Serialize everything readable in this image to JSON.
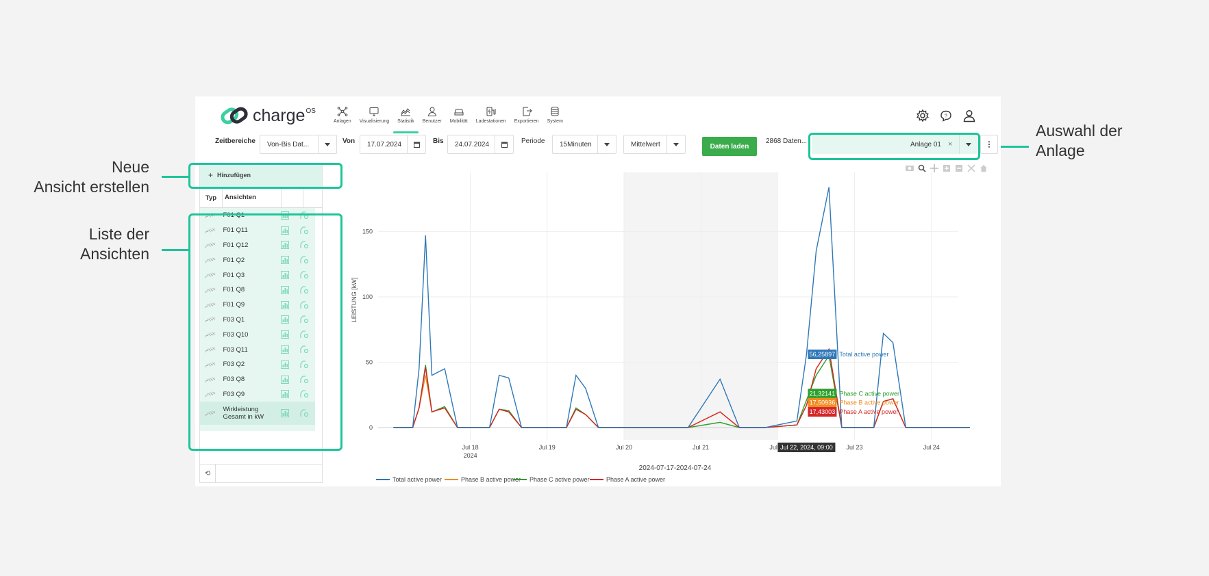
{
  "app": {
    "logo_text": "charge",
    "logo_sup": "OS",
    "nav": [
      {
        "label": "Anlagen",
        "icon": "network-icon"
      },
      {
        "label": "Visualisierung",
        "icon": "monitor-icon"
      },
      {
        "label": "Statistik",
        "icon": "chart-icon",
        "active": true
      },
      {
        "label": "Benutzer",
        "icon": "user-icon"
      },
      {
        "label": "Mobilität",
        "icon": "car-icon"
      },
      {
        "label": "Ladestationen",
        "icon": "charger-icon"
      },
      {
        "label": "Exportieren",
        "icon": "export-icon"
      },
      {
        "label": "System",
        "icon": "database-icon"
      }
    ],
    "header_icons": [
      "settings-icon",
      "chat-help-icon",
      "profile-icon"
    ]
  },
  "toolbar": {
    "zeitbereiche_label": "Zeitbereiche",
    "zeitbereiche_value": "Von-Bis Dat...",
    "von_label": "Von",
    "von_value": "17.07.2024",
    "bis_label": "Bis",
    "bis_value": "24.07.2024",
    "periode_label": "Periode",
    "periode_value": "15Minuten",
    "agg_value": "Mittelwert",
    "load_label": "Daten laden",
    "count_text": "2868 Daten...",
    "anlage_value": "Anlage 01",
    "clear_symbol": "×"
  },
  "sidebar": {
    "add_label": "Hinzufügen",
    "col_typ": "Typ",
    "col_ansichten": "Ansichten",
    "items": [
      "F01 Q1",
      "F01 Q11",
      "F01 Q12",
      "F01 Q2",
      "F01 Q3",
      "F01 Q8",
      "F01 Q9",
      "F03 Q1",
      "F03 Q10",
      "F03 Q11",
      "F03 Q2",
      "F03 Q8",
      "F03 Q9"
    ],
    "last_item_line1": "Wirkleistung",
    "last_item_line2": "Gesamt in kW"
  },
  "chart_data": {
    "type": "line",
    "ylabel": "LEISTUNG [kW]",
    "xlabel": "2024-07-17-2024-07-24",
    "x_ticks": [
      "Jul 18",
      "Jul 19",
      "Jul 20",
      "Jul 21",
      "Jul 22",
      "Jul 23",
      "Jul 24"
    ],
    "x_tick_year": "2024",
    "y_ticks": [
      0,
      50,
      100,
      150
    ],
    "ylim": [
      0,
      190
    ],
    "grid": true,
    "legend_position": "bottom",
    "hover_x_label": "Jul 22, 2024, 09:00",
    "series": [
      {
        "name": "Total active power",
        "color": "#2e78b8",
        "hover_value": "56,25897"
      },
      {
        "name": "Phase B active power",
        "color": "#f08c22",
        "hover_value": "17,50936"
      },
      {
        "name": "Phase C active power",
        "color": "#2ca02c",
        "hover_value": "21,32141"
      },
      {
        "name": "Phase A active power",
        "color": "#d62728",
        "hover_value": "17,43003"
      }
    ],
    "x": [
      "Jul 17 00:00",
      "Jul 17 06:00",
      "Jul 17 08:00",
      "Jul 17 10:00",
      "Jul 17 12:00",
      "Jul 17 16:00",
      "Jul 17 20:00",
      "Jul 18 06:00",
      "Jul 18 09:00",
      "Jul 18 12:00",
      "Jul 18 16:00",
      "Jul 18 20:00",
      "Jul 19 06:00",
      "Jul 19 09:00",
      "Jul 19 12:00",
      "Jul 19 16:00",
      "Jul 19 20:00",
      "Jul 20 06:00",
      "Jul 20 12:00",
      "Jul 20 20:00",
      "Jul 21 06:00",
      "Jul 21 12:00",
      "Jul 21 20:00",
      "Jul 22 06:00",
      "Jul 22 09:00",
      "Jul 22 12:00",
      "Jul 22 16:00",
      "Jul 22 20:00",
      "Jul 23 06:00",
      "Jul 23 09:00",
      "Jul 23 12:00",
      "Jul 23 16:00",
      "Jul 23 20:00",
      "Jul 24 06:00",
      "Jul 24 12:00"
    ],
    "values": {
      "Total active power": [
        0,
        0,
        45,
        147,
        40,
        45,
        0,
        0,
        40,
        38,
        0,
        0,
        0,
        40,
        30,
        0,
        0,
        0,
        0,
        0,
        37,
        0,
        0,
        5,
        56,
        135,
        184,
        0,
        0,
        72,
        65,
        0,
        0,
        0,
        0
      ],
      "Phase B active power": [
        0,
        0,
        15,
        40,
        12,
        15,
        0,
        0,
        14,
        12,
        0,
        0,
        0,
        14,
        10,
        0,
        0,
        0,
        0,
        0,
        12,
        0,
        0,
        2,
        17,
        45,
        60,
        0,
        0,
        20,
        22,
        0,
        0,
        0,
        0
      ],
      "Phase C active power": [
        0,
        0,
        15,
        48,
        12,
        16,
        0,
        0,
        14,
        13,
        0,
        0,
        0,
        15,
        10,
        0,
        0,
        0,
        0,
        0,
        4,
        0,
        0,
        2,
        21,
        40,
        55,
        0,
        0,
        20,
        22,
        0,
        0,
        0,
        0
      ],
      "Phase A active power": [
        0,
        0,
        15,
        46,
        12,
        15,
        0,
        0,
        14,
        12,
        0,
        0,
        0,
        14,
        10,
        0,
        0,
        0,
        0,
        0,
        12,
        0,
        0,
        2,
        17,
        45,
        60,
        0,
        0,
        20,
        22,
        0,
        0,
        0,
        0
      ]
    }
  },
  "annotations": {
    "neue_line1": "Neue",
    "neue_line2": "Ansicht erstellen",
    "liste_line1": "Liste der",
    "liste_line2": "Ansichten",
    "auswahl_line1": "Auswahl der",
    "auswahl_line2": "Anlage"
  }
}
